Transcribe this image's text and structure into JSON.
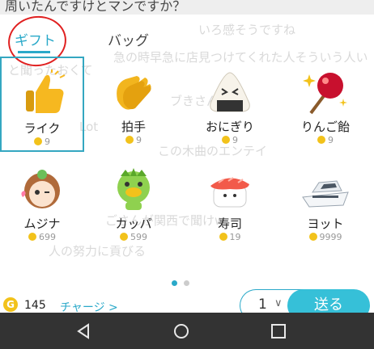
{
  "top_overflow_text": "周いたんですけとマンですか？",
  "ghost_chat": [
    "いろ感そうですね",
    "急の時早急に店見つけてくれた人そういう人い",
    "と聞ったおくて",
    "ブきさんw",
    "Lot",
    "この木曲のエンテイ",
    "ごさんが関西で聞けw",
    "人の努力に貢びる"
  ],
  "tabs": {
    "gift": "ギフト",
    "bag": "バッグ"
  },
  "gifts": [
    {
      "name": "ライク",
      "price": "9",
      "icon": "thumbs-up-icon",
      "selected": true
    },
    {
      "name": "拍手",
      "price": "9",
      "icon": "clapping-hands-icon"
    },
    {
      "name": "おにぎり",
      "price": "9",
      "icon": "onigiri-icon"
    },
    {
      "name": "りんご飴",
      "price": "9",
      "icon": "candy-apple-icon"
    },
    {
      "name": "ムジナ",
      "price": "699",
      "icon": "mujina-character-icon"
    },
    {
      "name": "カッパ",
      "price": "599",
      "icon": "kappa-character-icon"
    },
    {
      "name": "寿司",
      "price": "19",
      "icon": "sushi-icon"
    },
    {
      "name": "ヨット",
      "price": "9999",
      "icon": "yacht-icon"
    }
  ],
  "page_dots": {
    "active": 0,
    "count": 2
  },
  "bottom": {
    "balance": "145",
    "charge_label": "チャージ >",
    "quantity": "1",
    "send_label": "送る"
  },
  "colors": {
    "accent": "#2aa9c9",
    "send_button": "#36c0d8",
    "coin": "#f2c21b"
  }
}
